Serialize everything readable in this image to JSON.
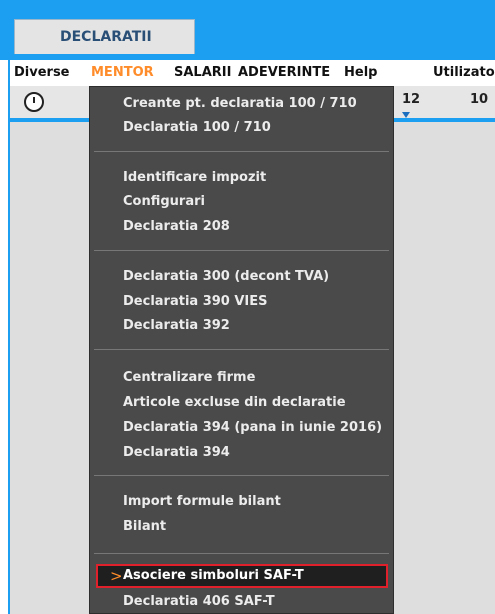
{
  "tab": {
    "label": "DECLARATII"
  },
  "menubar": {
    "items": [
      "Diverse",
      "MENTOR",
      "SALARII",
      "ADEVERINTE",
      "Help",
      "Utilizato"
    ],
    "active_index": 1
  },
  "toolbar": {
    "num1": "12",
    "num2": "10"
  },
  "dropdown": {
    "groups": [
      [
        "Creante pt. declaratia 100 / 710",
        "Declaratia 100 / 710"
      ],
      [
        "Identificare impozit",
        "Configurari",
        "Declaratia 208"
      ],
      [
        "Declaratia 300 (decont TVA)",
        "Declaratia 390 VIES",
        "Declaratia 392"
      ],
      [
        "Centralizare firme",
        "Articole excluse din declaratie",
        "Declaratia 394 (pana in iunie 2016)",
        "Declaratia 394"
      ],
      [
        "Import formule bilant",
        "Bilant"
      ]
    ],
    "highlighted": {
      "chevron": ">",
      "label": "Asociere simboluri SAF-T"
    },
    "last_item": "Declaratia 406 SAF-T"
  },
  "colors": {
    "title_blue": "#1c9ff0",
    "active_menu": "#ff8c2a",
    "menu_bg": "#4a4a4a",
    "highlight_border": "#e0202a"
  }
}
